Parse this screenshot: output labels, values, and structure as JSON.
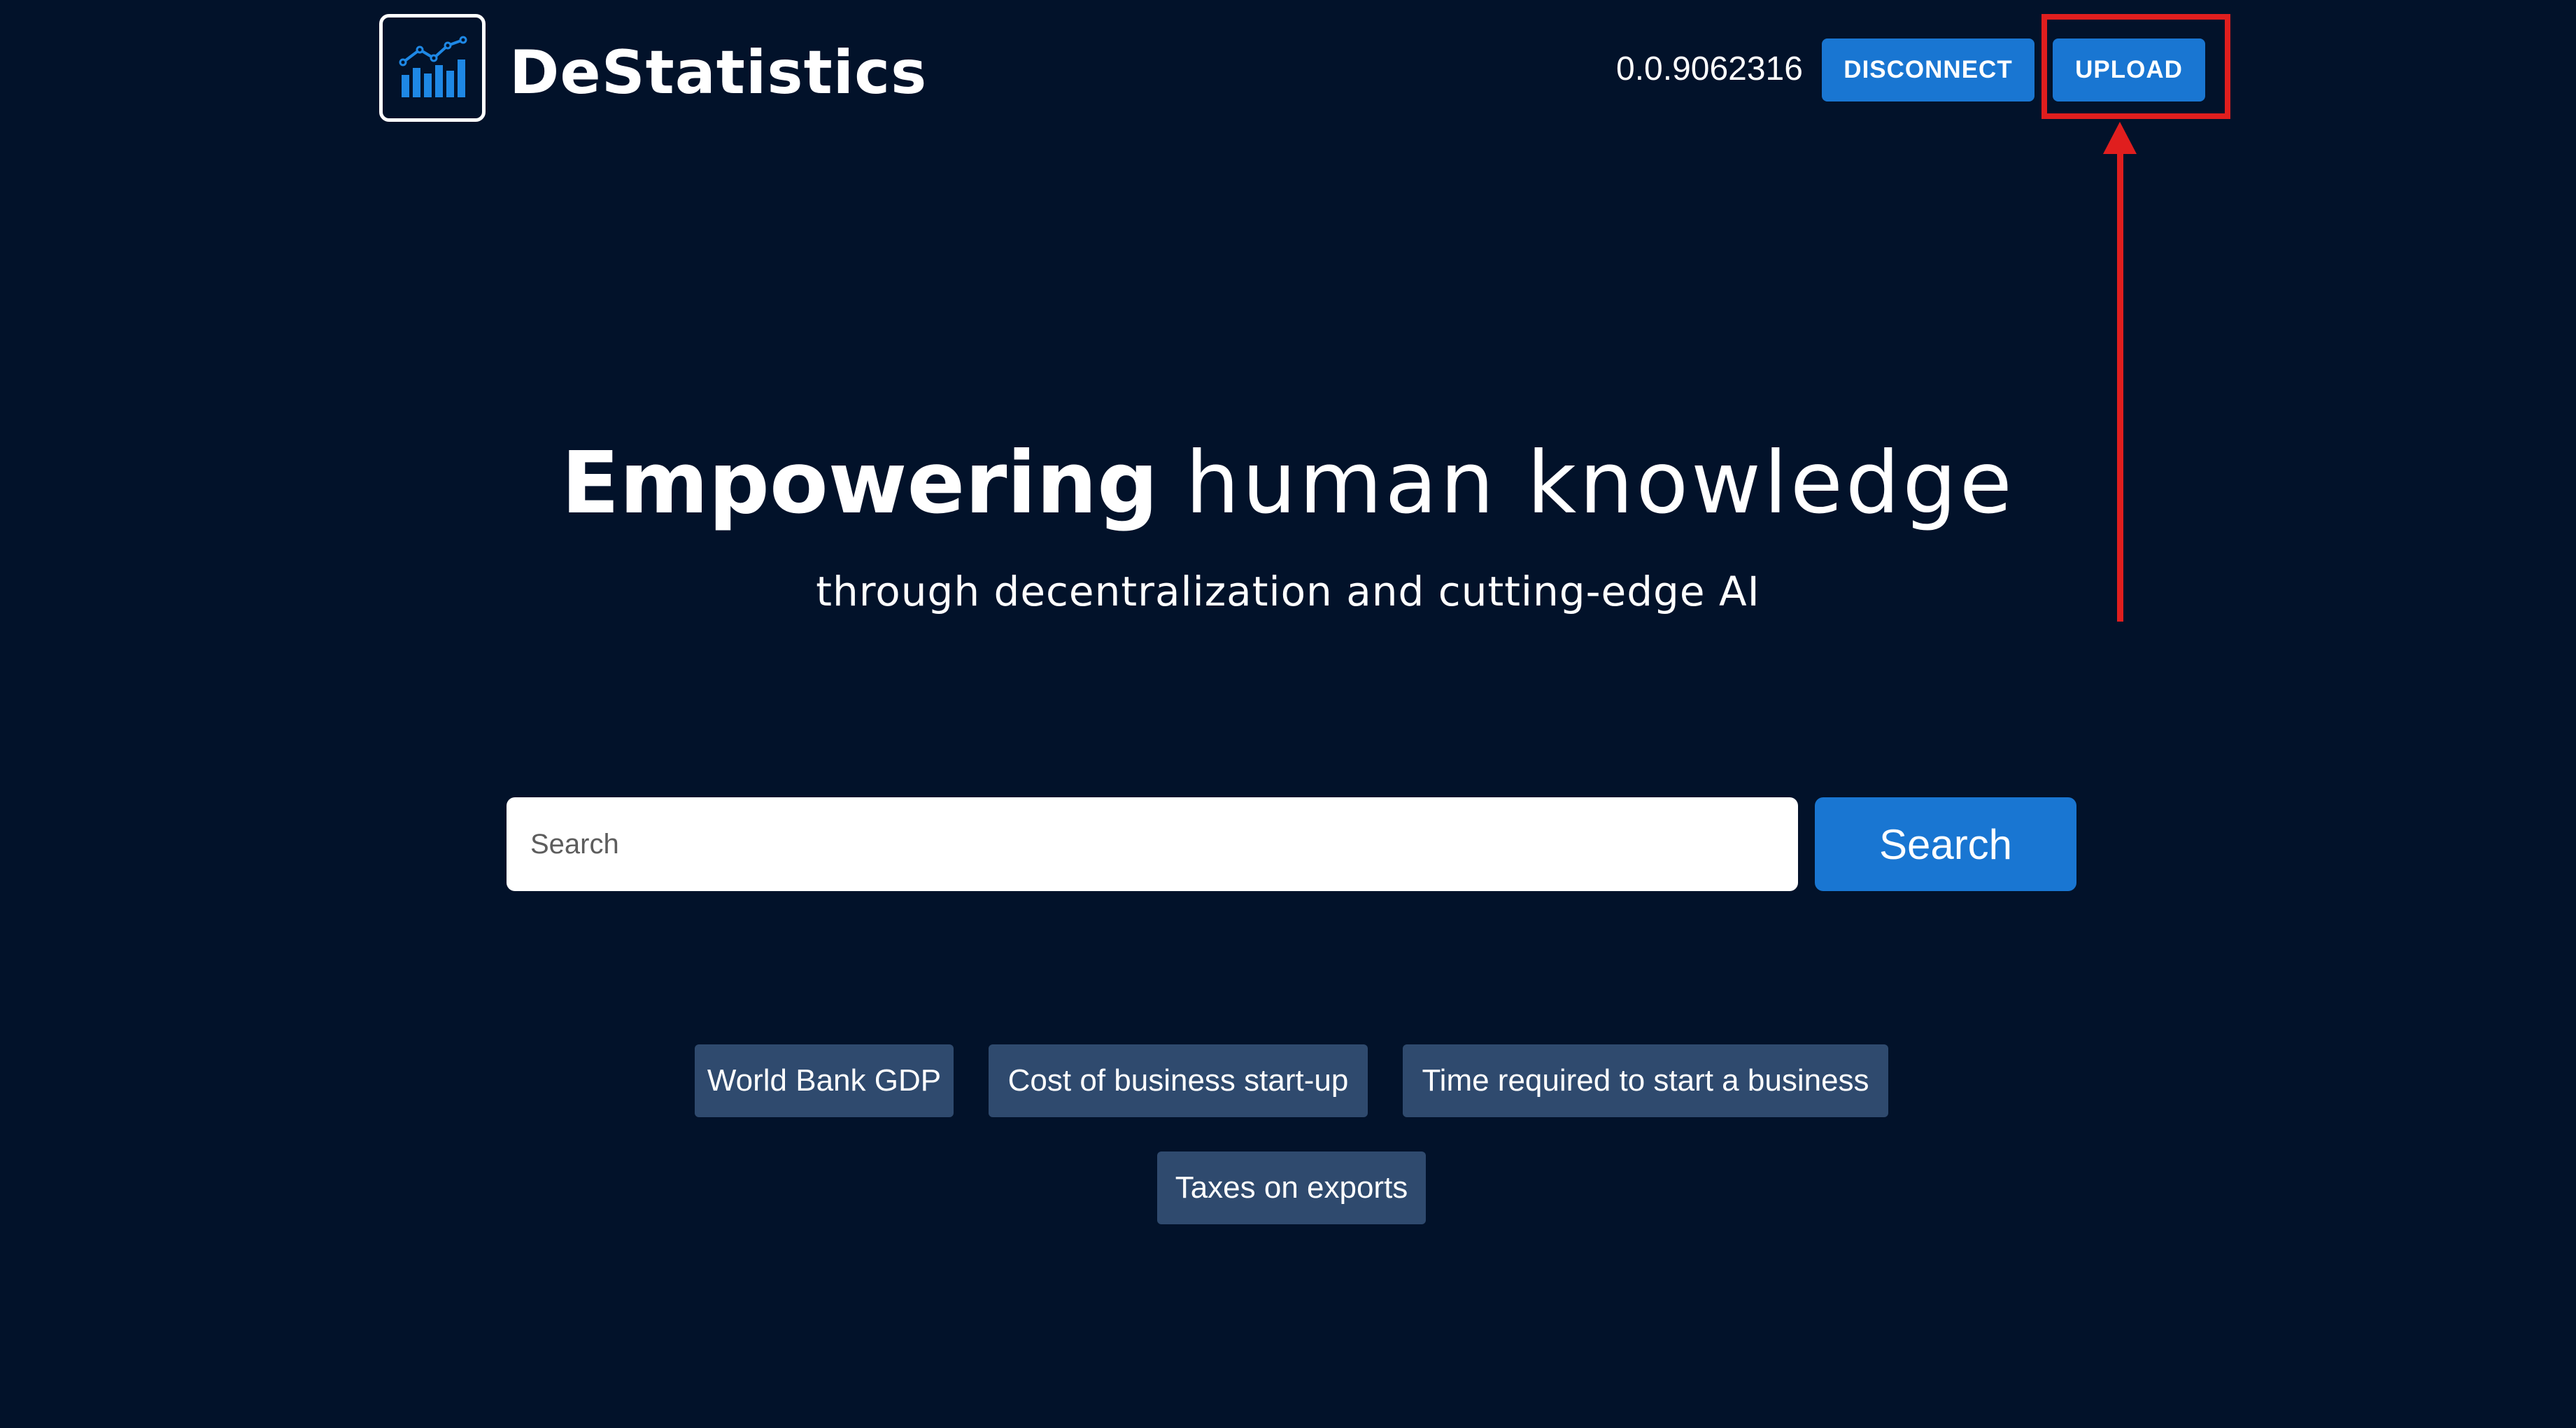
{
  "header": {
    "brand": "DeStatistics",
    "logo_icon": "bar-chart-trend-icon",
    "balance": "0.0.9062316",
    "disconnect_label": "DISCONNECT",
    "upload_label": "UPLOAD"
  },
  "hero": {
    "title_strong": "Empowering",
    "title_light": "human knowledge",
    "subtitle": "through decentralization and cutting-edge AI"
  },
  "search": {
    "placeholder": "Search",
    "button_label": "Search"
  },
  "suggestions": [
    "World Bank GDP",
    "Cost of business start-up",
    "Time required to start a business",
    "Taxes on exports"
  ],
  "colors": {
    "background": "#02122a",
    "primary_button": "#1976d2",
    "chip": "#2f4a6e",
    "annotation": "#e01e1e"
  }
}
